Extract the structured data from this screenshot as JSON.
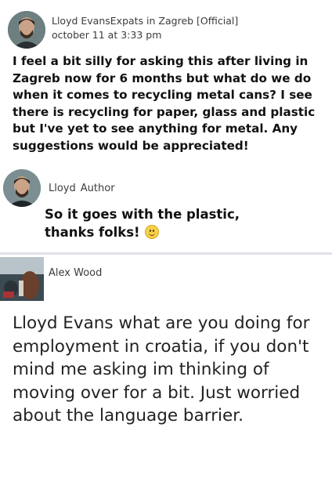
{
  "post": {
    "author_and_group": "Lloyd EvansExpats in Zagreb [Official]",
    "timestamp": "october 11 at 3:33 pm",
    "body": "I feel a bit silly for asking this after living in Zagreb now for 6 months but what do we do when it comes to recycling metal cans? I see there is recycling for paper, glass and plastic but I've yet to see anything for metal. Any suggestions would be appreciated!"
  },
  "comments": [
    {
      "name": "Lloyd",
      "badge": "Author",
      "body": "So it goes with the plastic, thanks folks!",
      "emoji": "slightly-smiling-face-emoji"
    },
    {
      "name": "Alex Wood",
      "body": "Lloyd Evans what are you doing for employment in croatia, if you don't mind me asking im thinking of moving over for a bit. Just worried about the language barrier."
    }
  ],
  "colors": {
    "divider": "#e1e1ea",
    "text": "#111111",
    "meta": "#3a3b3c"
  },
  "icons": [
    "avatar-lloyd",
    "avatar-alex",
    "smile-emoji"
  ]
}
